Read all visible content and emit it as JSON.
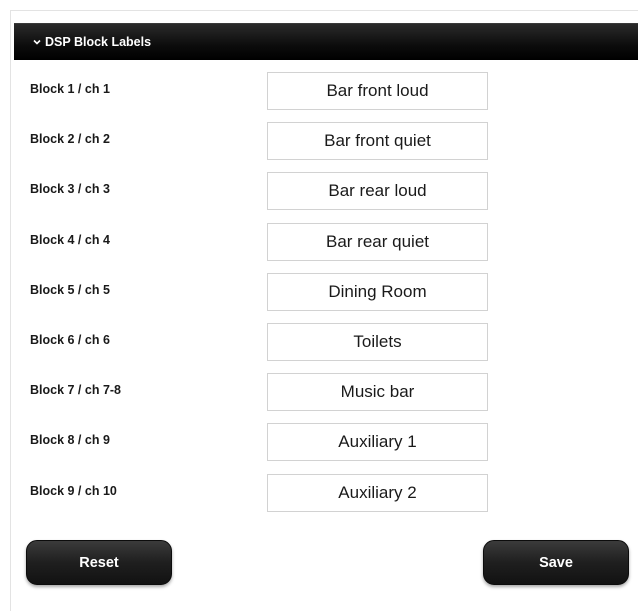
{
  "section": {
    "title": "DSP Block Labels"
  },
  "blocks": [
    {
      "label": "Block 1 / ch 1",
      "value": "Bar front loud"
    },
    {
      "label": "Block 2 / ch 2",
      "value": "Bar front quiet"
    },
    {
      "label": "Block 3 / ch 3",
      "value": "Bar rear loud"
    },
    {
      "label": "Block 4 / ch 4",
      "value": "Bar rear quiet"
    },
    {
      "label": "Block 5 / ch 5",
      "value": "Dining Room"
    },
    {
      "label": "Block 6 / ch 6",
      "value": "Toilets"
    },
    {
      "label": "Block 7 / ch 7-8",
      "value": "Music bar"
    },
    {
      "label": "Block 8 / ch 9",
      "value": "Auxiliary 1"
    },
    {
      "label": "Block 9 / ch 10",
      "value": "Auxiliary 2"
    }
  ],
  "actions": {
    "reset_label": "Reset",
    "save_label": "Save"
  },
  "icons": {
    "header_toggle": "chevron-down-icon"
  }
}
